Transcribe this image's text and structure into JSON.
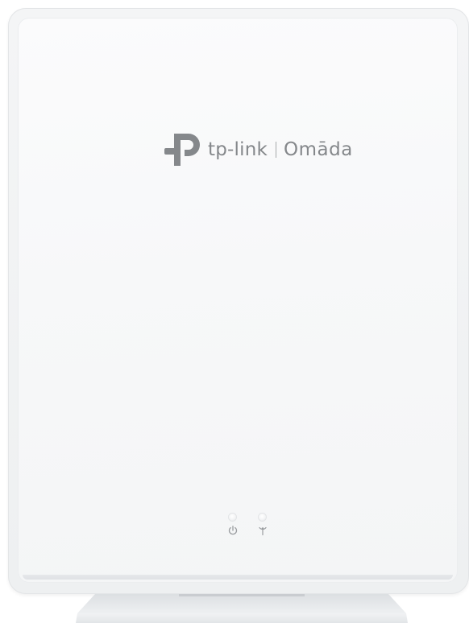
{
  "product": {
    "brand_wordmark": "tp-link",
    "series_wordmark": "Omāda",
    "logo_icon": "tp-link-logo-icon",
    "indicators": [
      {
        "name": "power",
        "icon": "power-icon"
      },
      {
        "name": "wireless",
        "icon": "wireless-antenna-icon"
      }
    ],
    "colors": {
      "body": "#f6f7f8",
      "logo": "#85888b"
    }
  }
}
